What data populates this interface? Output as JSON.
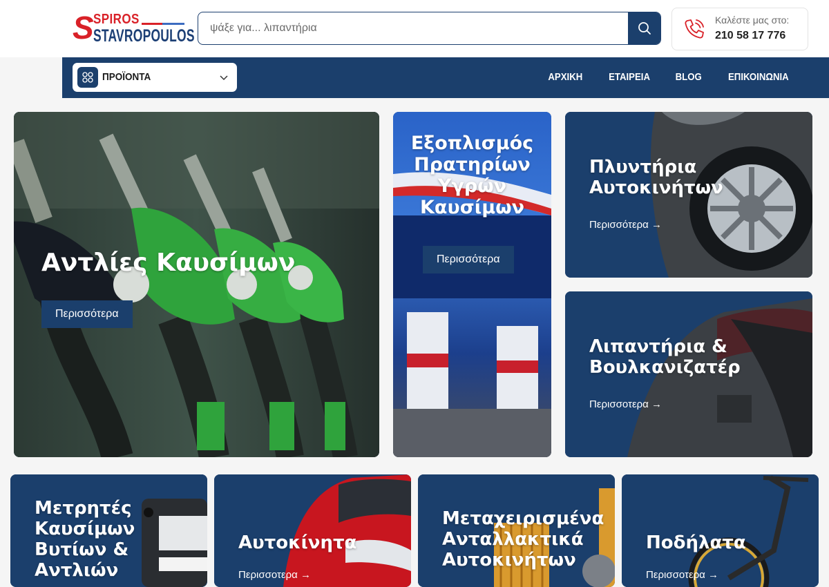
{
  "brand": {
    "logo_top": "SPIROS",
    "logo_bottom": "STAVROPOULOS"
  },
  "search": {
    "placeholder": "ψάξε για... λιπαντήρια"
  },
  "contact": {
    "label": "Καλέστε μας στο:",
    "phone": "210 58 17 776"
  },
  "nav": {
    "products_label": "ΠΡΟΪΟΝΤΑ",
    "links": [
      "ΑΡΧΙΚΗ",
      "ΕΤΑΙΡΕΙΑ",
      "BLOG",
      "ΕΠΙΚΟΙΝΩΝΙΑ"
    ]
  },
  "cards": {
    "fuel_pumps": {
      "title": "Αντλίες Καυσίμων",
      "more": "Περισσότερα"
    },
    "station_equipment": {
      "title": "Εξοπλισμός Πρατηρίων Υγρών Καυσίμων",
      "more": "Περισσότερα"
    },
    "car_wash": {
      "title": "Πλυντήρια Αυτοκινήτων",
      "more": "Περισσότερα →"
    },
    "lubricators": {
      "title": "Λιπαντήρια & Βουλκανιζατέρ",
      "more": "Περισσοτερα →"
    },
    "meters": {
      "title": "Μετρητές Καυσίμων Βυτίων & Αντλιών"
    },
    "cars": {
      "title": "Αυτοκίνητα",
      "more": "Περισσοτερα →"
    },
    "used_parts": {
      "title": "Μεταχειρισμένα Ανταλλακτικά Αυτοκινήτων"
    },
    "bicycles": {
      "title": "Ποδήλατα",
      "more": "Περισσοτερα →"
    }
  },
  "colors": {
    "primary": "#1b3f6c",
    "brand_red": "#d92128",
    "nozzle_green": "#2fa33c"
  }
}
